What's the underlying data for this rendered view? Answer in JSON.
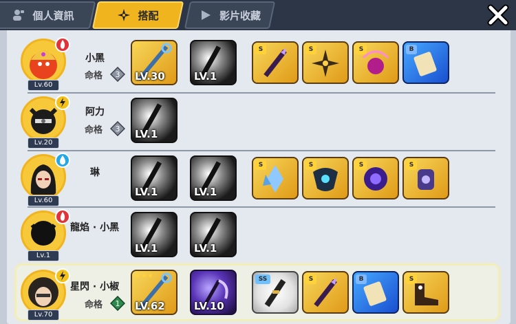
{
  "tabs": [
    {
      "label": "個人資訊",
      "icon": "profile-icon",
      "active": false
    },
    {
      "label": "搭配",
      "icon": "shuriken-icon",
      "active": true
    },
    {
      "label": "影片收藏",
      "icon": "play-icon",
      "active": false
    }
  ],
  "fate_label": "命格",
  "characters": [
    {
      "name": "小黑",
      "level": "Lv.60",
      "element": "fire-icon",
      "fate_rank": "3",
      "weapons": [
        {
          "level": "LV.30",
          "stars": "★"
        },
        {
          "level": "LV.1",
          "stars": ""
        }
      ],
      "items": [
        {
          "grade": "S"
        },
        {
          "grade": "S"
        },
        {
          "grade": "S"
        },
        {
          "grade": "B"
        }
      ]
    },
    {
      "name": "阿力",
      "level": "Lv.20",
      "element": "lightning-icon",
      "fate_rank": "3",
      "weapons": [
        {
          "level": "LV.1",
          "stars": ""
        }
      ],
      "items": []
    },
    {
      "name": "琳",
      "level": "Lv.60",
      "element": "water-icon",
      "fate_rank": "",
      "weapons": [
        {
          "level": "LV.1",
          "stars": ""
        },
        {
          "level": "LV.1",
          "stars": ""
        }
      ],
      "items": [
        {
          "grade": "S"
        },
        {
          "grade": "S"
        },
        {
          "grade": "S"
        },
        {
          "grade": "S"
        }
      ]
    },
    {
      "name": "龍焰 · 小黑",
      "level": "Lv.1",
      "element": "fire-icon",
      "fate_rank": "",
      "weapons": [
        {
          "level": "LV.1",
          "stars": ""
        },
        {
          "level": "LV.1",
          "stars": ""
        }
      ],
      "items": []
    },
    {
      "name": "星閃 · 小椒",
      "level": "Lv.70",
      "element": "lightning-icon",
      "fate_rank": "1",
      "weapons": [
        {
          "level": "LV.62",
          "stars": "★★★"
        },
        {
          "level": "LV.10",
          "stars": ""
        }
      ],
      "items": [
        {
          "grade": "SS"
        },
        {
          "grade": "S"
        },
        {
          "grade": "B"
        },
        {
          "grade": "S"
        }
      ]
    }
  ],
  "colors": {
    "accent": "#f0b41e",
    "fire": "#e0343a",
    "lightning": "#f2c21a",
    "water": "#22a8e8"
  }
}
